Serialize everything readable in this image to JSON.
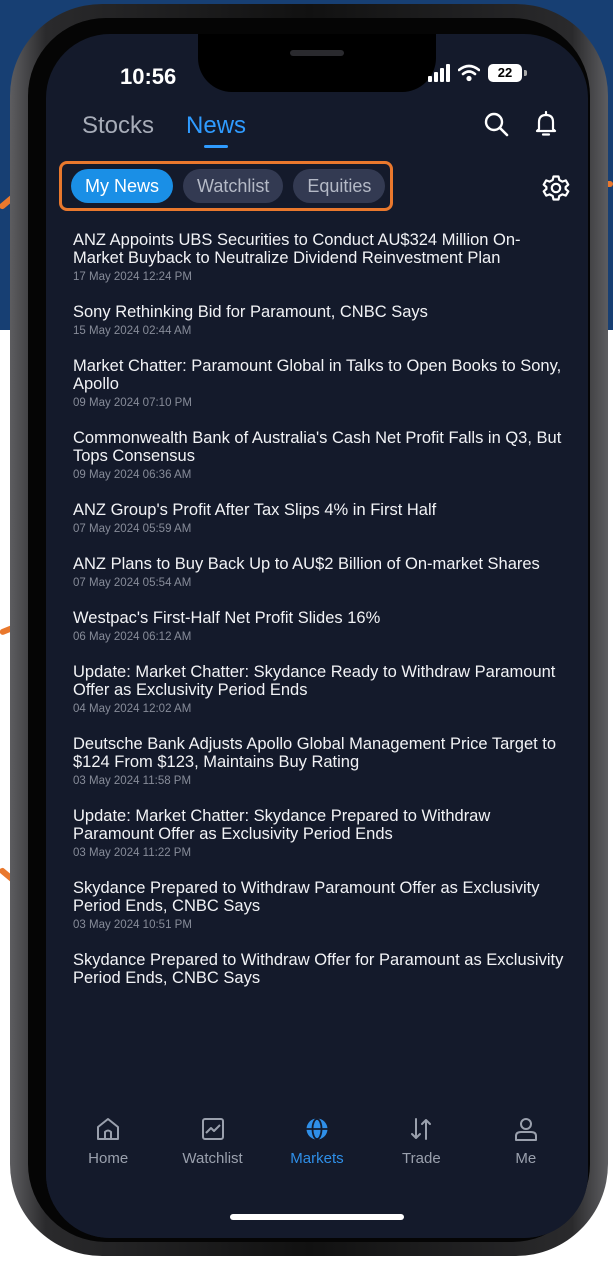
{
  "status_bar": {
    "time": "10:56",
    "battery": "22"
  },
  "top_tabs": [
    {
      "label": "Stocks",
      "active": false
    },
    {
      "label": "News",
      "active": true
    }
  ],
  "filter_chips": [
    {
      "label": "My News",
      "active": true
    },
    {
      "label": "Watchlist",
      "active": false
    },
    {
      "label": "Equities",
      "active": false
    }
  ],
  "news": [
    {
      "headline": "ANZ Appoints UBS Securities to Conduct AU$324 Million On-Market Buyback to Neutralize Dividend Reinvestment Plan",
      "date": "17 May 2024 12:24 PM"
    },
    {
      "headline": "Sony Rethinking Bid for Paramount, CNBC Says",
      "date": "15 May 2024 02:44 AM"
    },
    {
      "headline": "Market Chatter: Paramount Global in Talks to Open Books to Sony, Apollo",
      "date": "09 May 2024 07:10 PM"
    },
    {
      "headline": "Commonwealth Bank of Australia's Cash Net Profit Falls in Q3, But Tops Consensus",
      "date": "09 May 2024 06:36 AM"
    },
    {
      "headline": "ANZ Group's Profit After Tax Slips 4% in First Half",
      "date": "07 May 2024 05:59 AM"
    },
    {
      "headline": "ANZ Plans to Buy Back Up to AU$2 Billion of On-market Shares",
      "date": "07 May 2024 05:54 AM"
    },
    {
      "headline": "Westpac's First-Half Net Profit Slides 16%",
      "date": "06 May 2024 06:12 AM"
    },
    {
      "headline": "Update: Market Chatter: Skydance Ready to Withdraw Paramount Offer as Exclusivity Period Ends",
      "date": "04 May 2024 12:02 AM"
    },
    {
      "headline": "Deutsche Bank Adjusts Apollo Global Management Price Target to $124 From $123, Maintains Buy Rating",
      "date": "03 May 2024 11:58 PM"
    },
    {
      "headline": "Update: Market Chatter: Skydance Prepared to Withdraw Paramount Offer as Exclusivity Period Ends",
      "date": "03 May 2024 11:22 PM"
    },
    {
      "headline": "Skydance Prepared to Withdraw Paramount Offer as Exclusivity Period Ends, CNBC Says",
      "date": "03 May 2024 10:51 PM"
    },
    {
      "headline": "Skydance Prepared to Withdraw Offer for Paramount as Exclusivity Period Ends, CNBC Says",
      "date": ""
    }
  ],
  "bottom_nav": [
    {
      "label": "Home",
      "icon": "home-icon",
      "active": false
    },
    {
      "label": "Watchlist",
      "icon": "chart-icon",
      "active": false
    },
    {
      "label": "Markets",
      "icon": "globe-icon",
      "active": true
    },
    {
      "label": "Trade",
      "icon": "swap-arrows-icon",
      "active": false
    },
    {
      "label": "Me",
      "icon": "person-icon",
      "active": false
    }
  ],
  "colors": {
    "accent": "#2f9bff",
    "callout": "#e9782d",
    "screen_bg": "#141a2b",
    "brand_band": "#173f73"
  }
}
